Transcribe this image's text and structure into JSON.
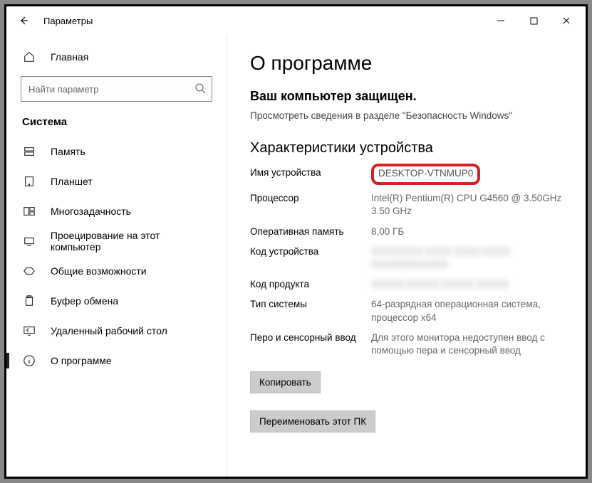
{
  "window": {
    "title": "Параметры"
  },
  "sidebar": {
    "home": "Главная",
    "search_placeholder": "Найти параметр",
    "section": "Система",
    "items": [
      {
        "label": "Память"
      },
      {
        "label": "Планшет"
      },
      {
        "label": "Многозадачность"
      },
      {
        "label": "Проецирование на этот компьютер"
      },
      {
        "label": "Общие возможности"
      },
      {
        "label": "Буфер обмена"
      },
      {
        "label": "Удаленный рабочий стол"
      },
      {
        "label": "О программе",
        "active": true
      }
    ]
  },
  "main": {
    "title": "О программе",
    "protected": "Ваш компьютер защищен.",
    "security_link": "Просмотреть сведения в разделе \"Безопасность Windows\"",
    "specs_title": "Характеристики устройства",
    "specs": {
      "device_name_label": "Имя устройства",
      "device_name_value": "DESKTOP-VTNMUP0",
      "cpu_label": "Процессор",
      "cpu_value": "Intel(R) Pentium(R) CPU G4560 @ 3.50GHz   3.50 GHz",
      "ram_label": "Оперативная память",
      "ram_value": "8,00 ГБ",
      "devid_label": "Код устройства",
      "devid_value": "XXXXXXXX-XXXX-XXXX-XXXX-XXXXXXXXXXXX",
      "prodid_label": "Код продукта",
      "prodid_value": "XXXXX-XXXXX-XXXXX-XXXXX",
      "systype_label": "Тип системы",
      "systype_value": "64-разрядная операционная система, процессор x64",
      "pen_label": "Перо и сенсорный ввод",
      "pen_value": "Для этого монитора недоступен ввод с помощью пера и сенсорный ввод"
    },
    "copy_btn": "Копировать",
    "rename_btn": "Переименовать этот ПК"
  }
}
